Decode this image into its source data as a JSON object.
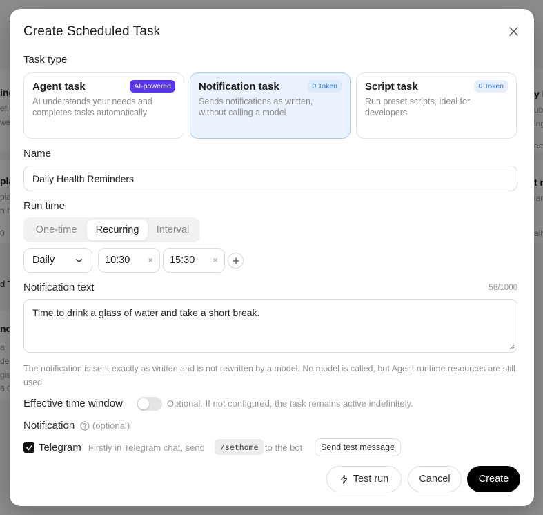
{
  "background": {
    "left_items": [
      {
        "title": "ing",
        "sub1": "efi",
        "sub2": "wa"
      },
      {
        "title": "pla",
        "sub1": "plan",
        "sub2": "n ho",
        "meta": "0"
      },
      {
        "title": "d T",
        "sub1": "",
        "sub2": ""
      },
      {
        "title": "nd",
        "sub1": "a",
        "sub2": "de:",
        "sub3": "gis",
        "sub4": "6:0"
      }
    ],
    "right_items": [
      {
        "title": "y Bu",
        "sub1": "ubit",
        "sub2": "ing",
        "meta": "eek"
      },
      {
        "title": "t n",
        "sub1": "ian",
        "meta": "aily"
      }
    ]
  },
  "modal": {
    "title": "Create Scheduled Task",
    "close_icon": "close-icon"
  },
  "task_type": {
    "label": "Task type",
    "options": [
      {
        "title": "Agent task",
        "badge": "AI-powered",
        "desc": "AI understands your needs and completes tasks automatically",
        "selected": false
      },
      {
        "title": "Notification task",
        "badge": "0 Token",
        "desc": "Sends notifications as written, without calling a model",
        "selected": true
      },
      {
        "title": "Script task",
        "badge": "0 Token",
        "desc": "Run preset scripts, ideal for developers",
        "selected": false
      }
    ]
  },
  "name": {
    "label": "Name",
    "value": "Daily Health Reminders"
  },
  "run_time": {
    "label": "Run time",
    "modes": [
      "One-time",
      "Recurring",
      "Interval"
    ],
    "active_mode": "Recurring",
    "frequency": "Daily",
    "times": [
      "10:30",
      "15:30"
    ],
    "add_icon": "plus-icon"
  },
  "notification_text": {
    "label": "Notification text",
    "count": "56/1000",
    "value": "Time to drink a glass of water and take a short break.",
    "helper": "The notification is sent exactly as written and is not rewritten by a model. No model is called, but Agent runtime resources are still used."
  },
  "effective_window": {
    "label": "Effective time window",
    "enabled": false,
    "hint": "Optional. If not configured, the task remains active indefinitely."
  },
  "notification": {
    "label": "Notification",
    "optional": "(optional)",
    "channel": "Telegram",
    "checked": true,
    "instruction_prefix": "Firstly in Telegram chat, send",
    "command": "/sethome",
    "instruction_suffix": "to the bot",
    "test_button": "Send test message"
  },
  "footer": {
    "test_run": "Test run",
    "cancel": "Cancel",
    "create": "Create"
  },
  "colors": {
    "accent_purple": "#5b35e8",
    "selected_bg": "#eaf3fd",
    "token_text": "#2f6fd1",
    "primary": "#000000"
  }
}
